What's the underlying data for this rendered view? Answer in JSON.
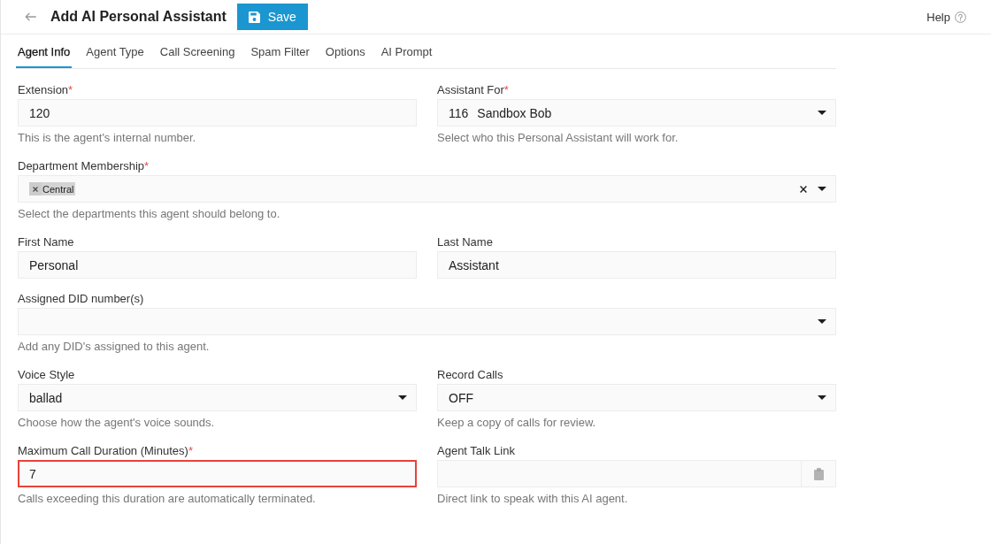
{
  "header": {
    "title": "Add AI Personal Assistant",
    "save_label": "Save",
    "help_label": "Help"
  },
  "tabs": [
    {
      "label": "Agent Info",
      "selected": true
    },
    {
      "label": "Agent Type",
      "selected": false
    },
    {
      "label": "Call Screening",
      "selected": false
    },
    {
      "label": "Spam Filter",
      "selected": false
    },
    {
      "label": "Options",
      "selected": false
    },
    {
      "label": "AI Prompt",
      "selected": false
    }
  ],
  "form": {
    "sections": [
      {
        "rows": [
          {
            "fields": [
              {
                "kind": "text",
                "label": "Extension",
                "required_mark": "*",
                "value": "120",
                "help": "This is the agent's internal number.",
                "invalid": false
              },
              {
                "kind": "select",
                "label": "Assistant For",
                "required_mark": "*",
                "prefix": "116",
                "value": "Sandbox Bob",
                "help": "Select who this Personal Assistant will work for.",
                "invalid": false
              }
            ]
          },
          {
            "fields": [
              {
                "kind": "multiselect",
                "label": "Department Membership",
                "required_mark": "*",
                "tags": [
                  {
                    "label": "Central"
                  }
                ],
                "help": "Select the departments this agent should belong to.",
                "invalid": false
              }
            ]
          },
          {
            "fields": [
              {
                "kind": "text",
                "label": "First Name",
                "value": "Personal",
                "invalid": false
              },
              {
                "kind": "text",
                "label": "Last Name",
                "value": "Assistant",
                "invalid": false
              }
            ]
          },
          {
            "fields": [
              {
                "kind": "select",
                "label": "Assigned DID number(s)",
                "help": "Add any DID's assigned to this agent.",
                "invalid": false
              }
            ]
          }
        ]
      },
      {
        "rows": [
          {
            "fields": [
              {
                "kind": "select",
                "label": "Voice Style",
                "value": "ballad",
                "help": "Choose how the agent's voice sounds.",
                "invalid": false
              },
              {
                "kind": "select",
                "label": "Record Calls",
                "value": "OFF",
                "help": "Keep a copy of calls for review.",
                "invalid": false
              }
            ]
          },
          {
            "fields": [
              {
                "kind": "text",
                "label": "Maximum Call Duration (Minutes)",
                "required_mark": "*",
                "value": "7",
                "help": "Calls exceeding this duration are automatically terminated.",
                "invalid": true
              },
              {
                "kind": "link",
                "label": "Agent Talk Link",
                "help": "Direct link to speak with this AI agent.",
                "invalid": false
              }
            ]
          }
        ]
      }
    ]
  }
}
